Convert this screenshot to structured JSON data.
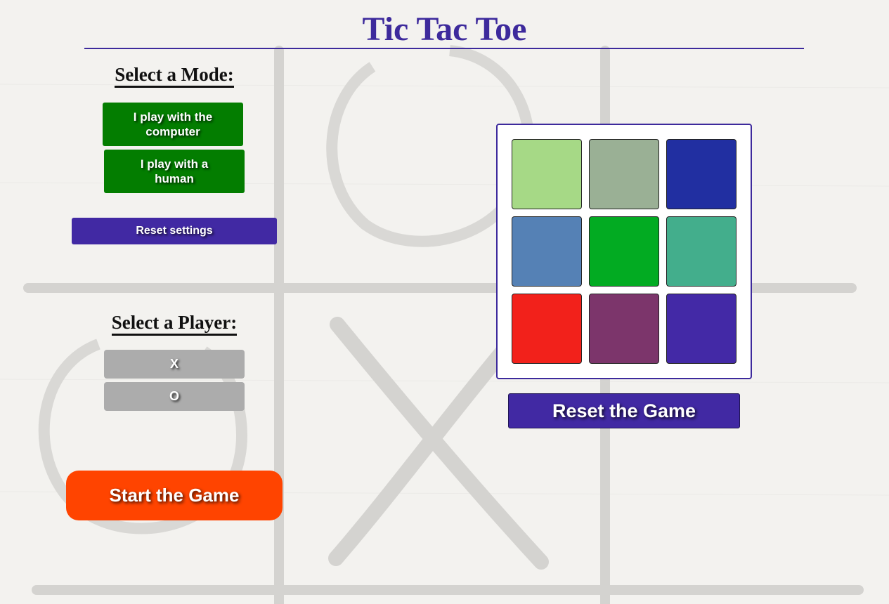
{
  "title": "Tic Tac Toe",
  "mode_section": {
    "heading": "Select a Mode:",
    "computer_button": "I play with the computer",
    "human_button": "I play with a human",
    "reset_settings_button": "Reset settings"
  },
  "player_section": {
    "heading": "Select a Player:",
    "x_button": "X",
    "o_button": "O"
  },
  "start_button": "Start the Game",
  "reset_game_button": "Reset the Game",
  "board": {
    "cells": [
      {
        "color": "#a6d986"
      },
      {
        "color": "#9ab095"
      },
      {
        "color": "#212fa1"
      },
      {
        "color": "#5581b5"
      },
      {
        "color": "#02ab22"
      },
      {
        "color": "#43ae8c"
      },
      {
        "color": "#f2211b"
      },
      {
        "color": "#7c356b"
      },
      {
        "color": "#4329a6"
      }
    ]
  },
  "colors": {
    "accent": "#3d2a9c",
    "mode_button": "#037d00",
    "player_button": "#acacac",
    "start_button": "#ff4400",
    "reset_button": "#4129a3"
  }
}
